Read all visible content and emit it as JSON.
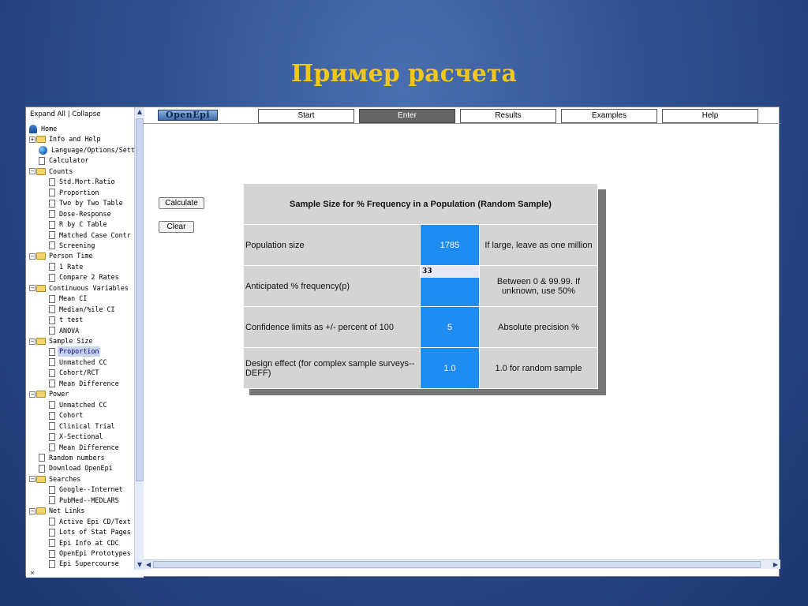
{
  "slide": {
    "title": "Пример расчета"
  },
  "tree": {
    "header": "Expand All | Collapse",
    "items": [
      {
        "label": "Home",
        "level": 0,
        "icon": "home"
      },
      {
        "label": "Info and Help",
        "level": 0,
        "icon": "folder",
        "toggle": "+"
      },
      {
        "label": "Language/Options/Setti",
        "level": 1,
        "icon": "globe"
      },
      {
        "label": "Calculator",
        "level": 1,
        "icon": "doc"
      },
      {
        "label": "Counts",
        "level": 0,
        "icon": "folder",
        "toggle": "−"
      },
      {
        "label": "Std.Mort.Ratio",
        "level": 2,
        "icon": "doc"
      },
      {
        "label": "Proportion",
        "level": 2,
        "icon": "doc"
      },
      {
        "label": "Two by Two Table",
        "level": 2,
        "icon": "doc"
      },
      {
        "label": "Dose-Response",
        "level": 2,
        "icon": "doc"
      },
      {
        "label": "R by C Table",
        "level": 2,
        "icon": "doc"
      },
      {
        "label": "Matched Case Contr",
        "level": 2,
        "icon": "doc"
      },
      {
        "label": "Screening",
        "level": 2,
        "icon": "doc"
      },
      {
        "label": "Person Time",
        "level": 0,
        "icon": "folder",
        "toggle": "−"
      },
      {
        "label": "1 Rate",
        "level": 2,
        "icon": "doc"
      },
      {
        "label": "Compare 2 Rates",
        "level": 2,
        "icon": "doc"
      },
      {
        "label": "Continuous Variables",
        "level": 0,
        "icon": "folder",
        "toggle": "−"
      },
      {
        "label": "Mean CI",
        "level": 2,
        "icon": "doc"
      },
      {
        "label": "Median/%ile CI",
        "level": 2,
        "icon": "doc"
      },
      {
        "label": "t test",
        "level": 2,
        "icon": "doc"
      },
      {
        "label": "ANOVA",
        "level": 2,
        "icon": "doc"
      },
      {
        "label": "Sample Size",
        "level": 0,
        "icon": "folder",
        "toggle": "−"
      },
      {
        "label": "Proportion",
        "level": 2,
        "icon": "doc",
        "selected": true
      },
      {
        "label": "Unmatched CC",
        "level": 2,
        "icon": "doc"
      },
      {
        "label": "Cohort/RCT",
        "level": 2,
        "icon": "doc"
      },
      {
        "label": "Mean Difference",
        "level": 2,
        "icon": "doc"
      },
      {
        "label": "Power",
        "level": 0,
        "icon": "folder",
        "toggle": "−"
      },
      {
        "label": "Unmatched CC",
        "level": 2,
        "icon": "doc"
      },
      {
        "label": "Cohort",
        "level": 2,
        "icon": "doc"
      },
      {
        "label": "Clinical Trial",
        "level": 2,
        "icon": "doc"
      },
      {
        "label": "X-Sectional",
        "level": 2,
        "icon": "doc"
      },
      {
        "label": "Mean Difference",
        "level": 2,
        "icon": "doc"
      },
      {
        "label": "Random numbers",
        "level": 1,
        "icon": "doc"
      },
      {
        "label": "Download OpenEpi",
        "level": 1,
        "icon": "doc"
      },
      {
        "label": "Searches",
        "level": 0,
        "icon": "folder",
        "toggle": "−"
      },
      {
        "label": "Google--Internet",
        "level": 2,
        "icon": "doc"
      },
      {
        "label": "PubMed--MEDLARS",
        "level": 2,
        "icon": "doc"
      },
      {
        "label": "Net Links",
        "level": 0,
        "icon": "folder",
        "toggle": "−"
      },
      {
        "label": "Active Epi CD/Text",
        "level": 2,
        "icon": "doc"
      },
      {
        "label": "Lots of Stat Pages",
        "level": 2,
        "icon": "doc"
      },
      {
        "label": "Epi Info at CDC",
        "level": 2,
        "icon": "doc"
      },
      {
        "label": "OpenEpi Prototypes",
        "level": 2,
        "icon": "doc"
      },
      {
        "label": "Epi Supercourse",
        "level": 2,
        "icon": "doc"
      }
    ],
    "bottom_mark": "×"
  },
  "nav": {
    "logo": "OpenEpi",
    "tabs": [
      {
        "label": "Start",
        "active": false
      },
      {
        "label": "Enter",
        "active": true
      },
      {
        "label": "Results",
        "active": false
      },
      {
        "label": "Examples",
        "active": false
      },
      {
        "label": "Help",
        "active": false
      }
    ]
  },
  "buttons": {
    "calculate": "Calculate",
    "clear": "Clear"
  },
  "calc": {
    "title": "Sample Size for % Frequency in a Population (Random Sample)",
    "rows": [
      {
        "label": "Population size",
        "value": "1785",
        "note": "If large, leave as one million"
      },
      {
        "label": "Anticipated % frequency(p)",
        "input": "33",
        "note": "Between 0 & 99.99. If unknown, use 50%"
      },
      {
        "label": "Confidence limits as +/- percent of 100",
        "value": "5",
        "note": "Absolute precision %"
      },
      {
        "label": "Design effect (for complex sample surveys--DEFF)",
        "value": "1.0",
        "note": "1.0 for random sample"
      }
    ]
  },
  "colors": {
    "accent_cell": "#1e8cf0",
    "title": "#f2c818",
    "background": "#2e4f8f"
  }
}
